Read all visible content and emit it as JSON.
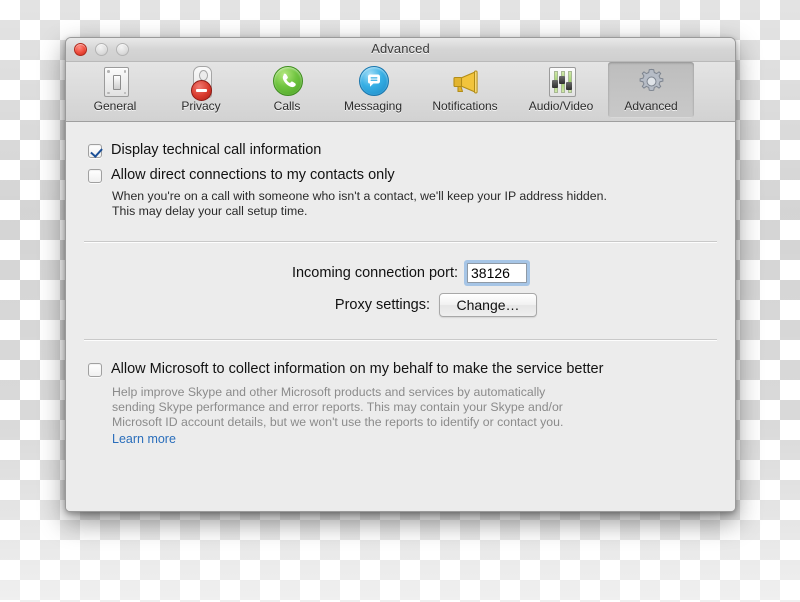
{
  "window": {
    "title": "Advanced",
    "traffic_lights": [
      {
        "name": "close-button",
        "color": "#ee4b3b"
      },
      {
        "name": "minimize-button",
        "color": "#dcdcdc"
      },
      {
        "name": "zoom-button",
        "color": "#dcdcdc"
      }
    ]
  },
  "toolbar": {
    "items": [
      {
        "label": "General",
        "icon": "switch-plate-icon",
        "selected": false
      },
      {
        "label": "Privacy",
        "icon": "door-hanger-no-entry-icon",
        "selected": false
      },
      {
        "label": "Calls",
        "icon": "phone-handset-icon",
        "selected": false
      },
      {
        "label": "Messaging",
        "icon": "chat-bubble-icon",
        "selected": false
      },
      {
        "label": "Notifications",
        "icon": "megaphone-icon",
        "selected": false
      },
      {
        "label": "Audio/Video",
        "icon": "equalizer-sliders-icon",
        "selected": false
      },
      {
        "label": "Advanced",
        "icon": "gear-icon",
        "selected": true
      }
    ]
  },
  "main": {
    "checkbox_display_tech": {
      "label": "Display technical call information",
      "checked": true
    },
    "checkbox_direct_connections": {
      "label": "Allow direct connections to my contacts only",
      "checked": false,
      "help_line1": "When you're on a call with someone who isn't a contact, we'll keep your IP address hidden.",
      "help_line2": "This may delay your call setup time."
    },
    "port_row": {
      "label": "Incoming connection port:",
      "value": "38126"
    },
    "proxy_row": {
      "label": "Proxy settings:",
      "button_label": "Change…"
    },
    "checkbox_telemetry": {
      "label": "Allow Microsoft to collect information on my behalf to make the service better",
      "checked": false,
      "help_line1": "Help improve Skype and other Microsoft products and services by automatically",
      "help_line2": "sending Skype performance and error reports. This may contain your Skype and/or",
      "help_line3": "Microsoft ID account details, but we won't use the reports to identify or contact you.",
      "link_label": "Learn more"
    }
  },
  "colors": {
    "accent_link": "#2a6ebb",
    "checkmark": "#1b4f96",
    "focus_ring": "#6ea5e1",
    "window_bg": "#ececec"
  }
}
